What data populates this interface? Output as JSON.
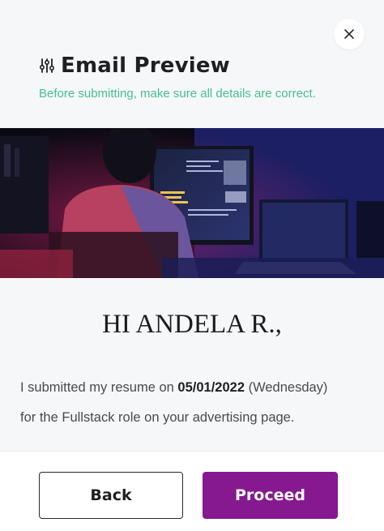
{
  "modal": {
    "title": "Email Preview",
    "subtitle": "Before submitting, make sure all details are correct.",
    "close_icon": "close-icon",
    "title_icon": "sliders-icon"
  },
  "hero": {
    "icon": "developer-at-monitors-photo"
  },
  "email": {
    "greeting": "HI ANDELA R.,",
    "line1_prefix": "I submitted my resume on ",
    "date": "05/01/2022",
    "day": " (Wednesday)",
    "line2": "for the Fullstack role on your advertising page."
  },
  "footer": {
    "back_label": "Back",
    "proceed_label": "Proceed"
  },
  "colors": {
    "accent_green": "#45c08f",
    "proceed_purple": "#86198f"
  }
}
